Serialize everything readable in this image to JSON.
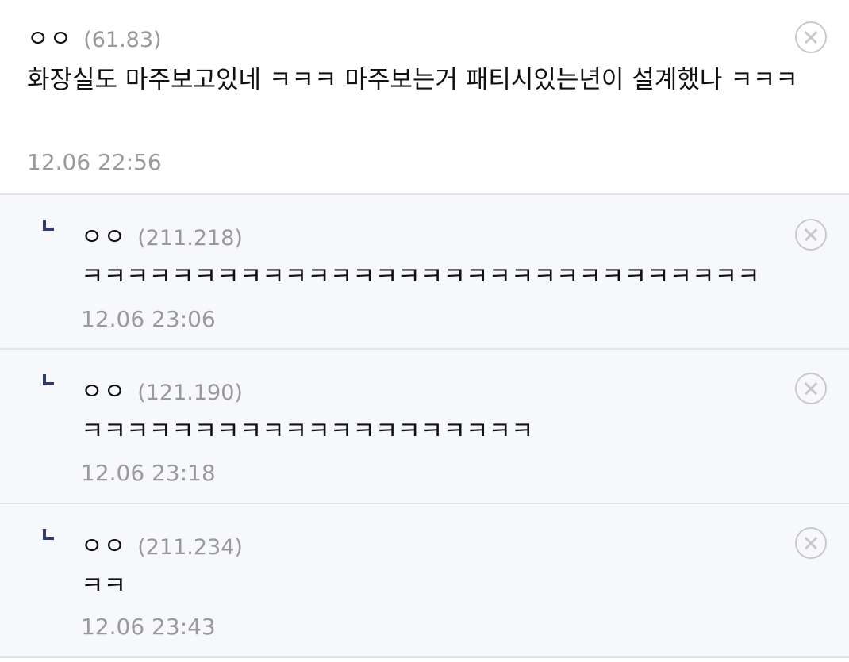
{
  "comments": [
    {
      "nick": "ㅇㅇ",
      "ip": "(61.83)",
      "text": "화장실도 마주보고있네 ㅋㅋㅋ 마주보는거 패티시있는년이 설계했나 ㅋㅋㅋ",
      "date": "12.06 22:56"
    }
  ],
  "replies": [
    {
      "nick": "ㅇㅇ",
      "ip": "(211.218)",
      "text": "ㅋㅋㅋㅋㅋㅋㅋㅋㅋㅋㅋㅋㅋㅋㅋㅋㅋㅋㅋㅋㅋㅋㅋㅋㅋㅋㅋㅋㅋㅋ",
      "date": "12.06 23:06"
    },
    {
      "nick": "ㅇㅇ",
      "ip": "(121.190)",
      "text": "ㅋㅋㅋㅋㅋㅋㅋㅋㅋㅋㅋㅋㅋㅋㅋㅋㅋㅋㅋㅋ",
      "date": "12.06 23:18"
    },
    {
      "nick": "ㅇㅇ",
      "ip": "(211.234)",
      "text": "ㅋㅋ",
      "date": "12.06 23:43"
    }
  ],
  "icons": {
    "delete": "close-circle-icon",
    "reply": "reply-arrow-icon"
  },
  "colors": {
    "reply_background": "#f7f8fb",
    "reply_marker": "#303a6b",
    "meta_text": "#999999",
    "divider": "#e3e4e8"
  }
}
